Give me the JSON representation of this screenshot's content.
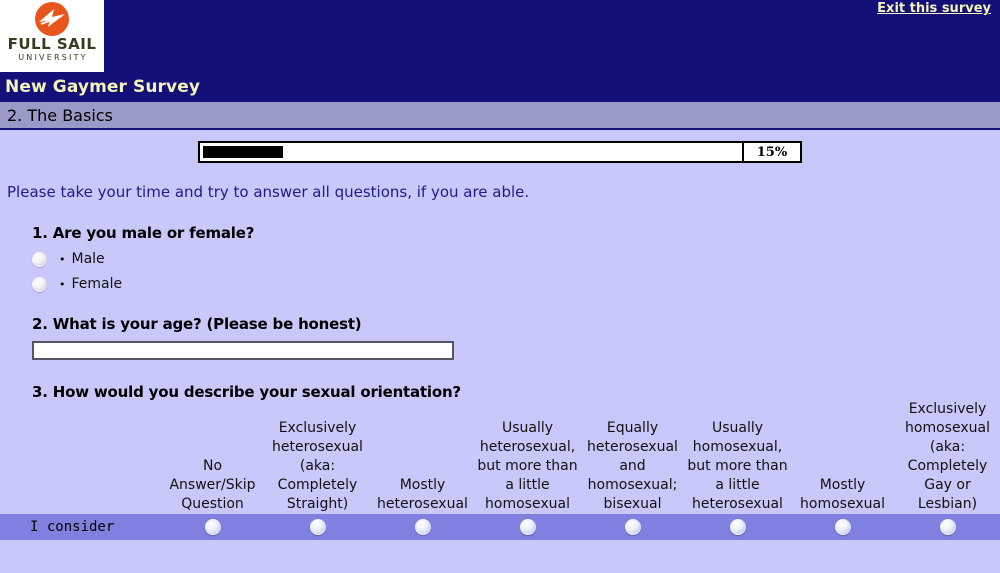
{
  "header": {
    "logo_word": "FULL SAIL",
    "logo_sub": "UNIVERSITY",
    "logo_icon": "sail-plane-icon",
    "exit_link": "Exit this survey",
    "survey_title": "New Gaymer Survey",
    "section_title": "2. The Basics",
    "navy": "#13107a",
    "accent_text": "#f4f4b8",
    "section_band": "#9a9ac8"
  },
  "progress": {
    "percent_label": "15%",
    "percent_value": 15,
    "fill_color": "#000000"
  },
  "intro": {
    "text": "Please take your time and try to answer all questions, if you are able.",
    "color": "#1c1c8c"
  },
  "questions": [
    {
      "number": "1.",
      "title": "1. Are you male or female?",
      "type": "radio",
      "bullet": "•",
      "choices": [
        "Male",
        "Female"
      ]
    },
    {
      "number": "2.",
      "title": "2. What is your age? (Please be honest)",
      "type": "text",
      "value": "",
      "placeholder": ""
    },
    {
      "number": "3.",
      "title": "3. How would you describe your sexual orientation?",
      "type": "matrix",
      "columns": [
        "No Answer/Skip Question",
        "Exclusively heterosexual (aka: Completely Straight)",
        "Mostly heterosexual",
        "Usually heterosexual, but more than a little homosexual",
        "Equally heterosexual and homosexual; bisexual",
        "Usually homosexual, but more than a little heterosexual",
        "Mostly homosexual",
        "Exclusively homosexual (aka: Completely Gay or Lesbian)"
      ],
      "rows": [
        "I consider"
      ],
      "row_band_color": "#8080e0"
    }
  ]
}
